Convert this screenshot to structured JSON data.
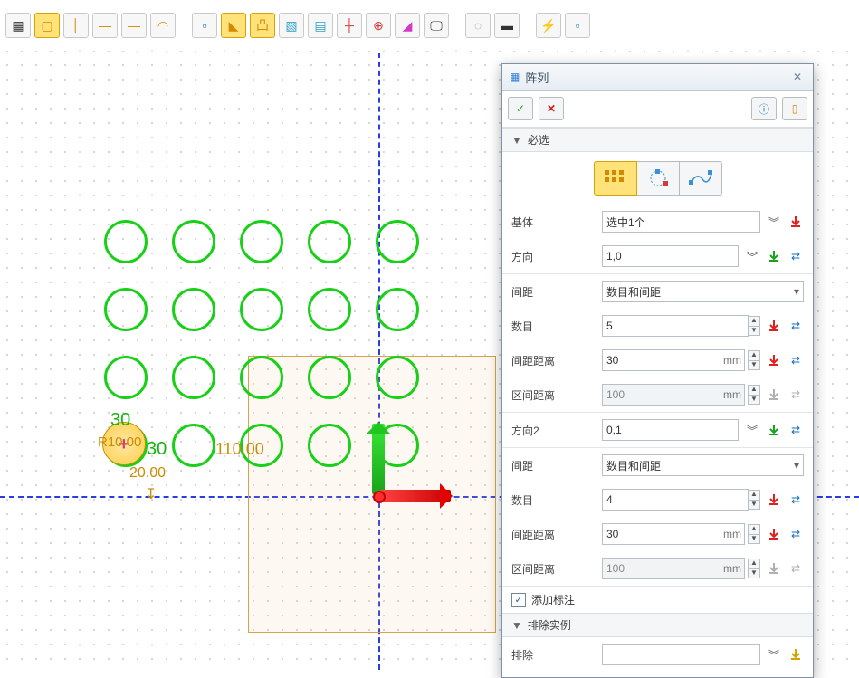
{
  "dialog": {
    "title": "阵列",
    "section_required": "必选",
    "section_exclude": "排除实例",
    "base_label": "基体",
    "base_value": "选中1个",
    "dir1_label": "方向",
    "dir1_value": "1,0",
    "spacing1_label": "间距",
    "spacing1_value": "数目和间距",
    "count1_label": "数目",
    "count1_value": "5",
    "pitch1_label": "间距距离",
    "pitch1_value": "30",
    "pitch1_unit": "mm",
    "range1_label": "区间距离",
    "range1_value": "100",
    "range1_unit": "mm",
    "dir2_label": "方向2",
    "dir2_value": "0,1",
    "spacing2_label": "间距",
    "spacing2_value": "数目和间距",
    "count2_label": "数目",
    "count2_value": "4",
    "pitch2_label": "间距距离",
    "pitch2_value": "30",
    "pitch2_unit": "mm",
    "range2_label": "区间距离",
    "range2_value": "100",
    "range2_unit": "mm",
    "add_anno_label": "添加标注",
    "exclude_label": "排除",
    "exclude_value": ""
  },
  "canvas": {
    "dim_y": "30",
    "dim_x": "30",
    "radius_label": "R10.00",
    "len_label": "110.00",
    "off_label": "20.00"
  },
  "icons": {
    "ok": "✓",
    "cancel": "✕",
    "close": "✕",
    "chev": "︾",
    "check": "✓",
    "tri": "▼",
    "info": "ⓘ"
  }
}
